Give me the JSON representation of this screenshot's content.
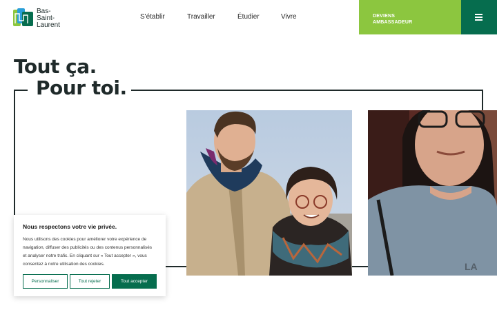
{
  "logo": {
    "lines": [
      "Bas-",
      "Saint-",
      "Laurent"
    ],
    "icon": "bas-saint-laurent-logo-mark"
  },
  "nav": {
    "items": [
      {
        "label": "S'établir"
      },
      {
        "label": "Travailler"
      },
      {
        "label": "Étudier"
      },
      {
        "label": "Vivre"
      }
    ]
  },
  "cta": {
    "line1": "DEVIENS",
    "line2": "AMBASSADEUR"
  },
  "menu": {
    "icon": "hamburger-menu-icon"
  },
  "hero": {
    "line1": "Tout ça.",
    "line2": "Pour toi."
  },
  "photos": [
    {
      "subject": "couple-smiling"
    },
    {
      "subject": "woman-with-glasses"
    }
  ],
  "cookie": {
    "title": "Nous respectons votre vie privée.",
    "body": "Nous utilisons des cookies pour améliorer votre expérience de navigation, diffuser des publicités ou des contenus personnalisés et analyser notre trafic. En cliquant sur « Tout accepter », vous consentez à notre utilisation des cookies.",
    "customize": "Personnaliser",
    "reject": "Tout rejeter",
    "accept": "Tout accepter"
  },
  "colors": {
    "green_light": "#8cc63f",
    "green_dark": "#066d4e",
    "text_dark": "#1f2a2a"
  }
}
